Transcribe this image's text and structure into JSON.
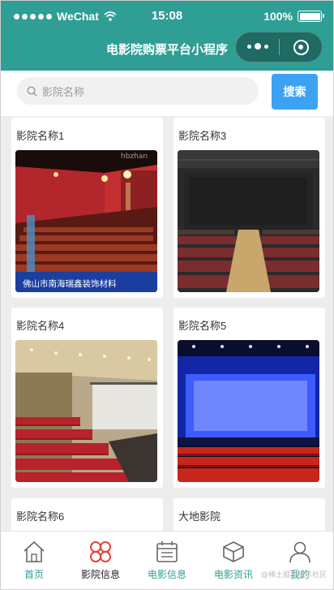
{
  "status_bar": {
    "carrier": "WeChat",
    "time": "15:08",
    "battery": "100%"
  },
  "header": {
    "title": "电影院购票平台小程序"
  },
  "search": {
    "placeholder": "影院名称",
    "button": "搜索"
  },
  "cinemas": [
    {
      "name": "影院名称1",
      "image_caption": "佛山市南海瑞鑫装饰材料",
      "image_watermark": "hbzhan"
    },
    {
      "name": "影院名称3"
    },
    {
      "name": "影院名称4"
    },
    {
      "name": "影院名称5"
    },
    {
      "name": "影院名称6"
    },
    {
      "name": "大地影院"
    }
  ],
  "tabbar": {
    "items": [
      {
        "label": "首页",
        "icon": "home-icon",
        "color": "#2f9e94"
      },
      {
        "label": "影院信息",
        "icon": "clover-icon",
        "color": "#222222"
      },
      {
        "label": "电影信息",
        "icon": "calendar-icon",
        "color": "#2f9e94"
      },
      {
        "label": "电影资讯",
        "icon": "cube-icon",
        "color": "#2f9e94"
      },
      {
        "label": "我的",
        "icon": "user-icon",
        "color": "#2f9e94"
      }
    ]
  },
  "watermark": "@稀土掘金技术社区",
  "colors": {
    "primary": "#2f9e94",
    "search_button": "#3ea2f4"
  }
}
